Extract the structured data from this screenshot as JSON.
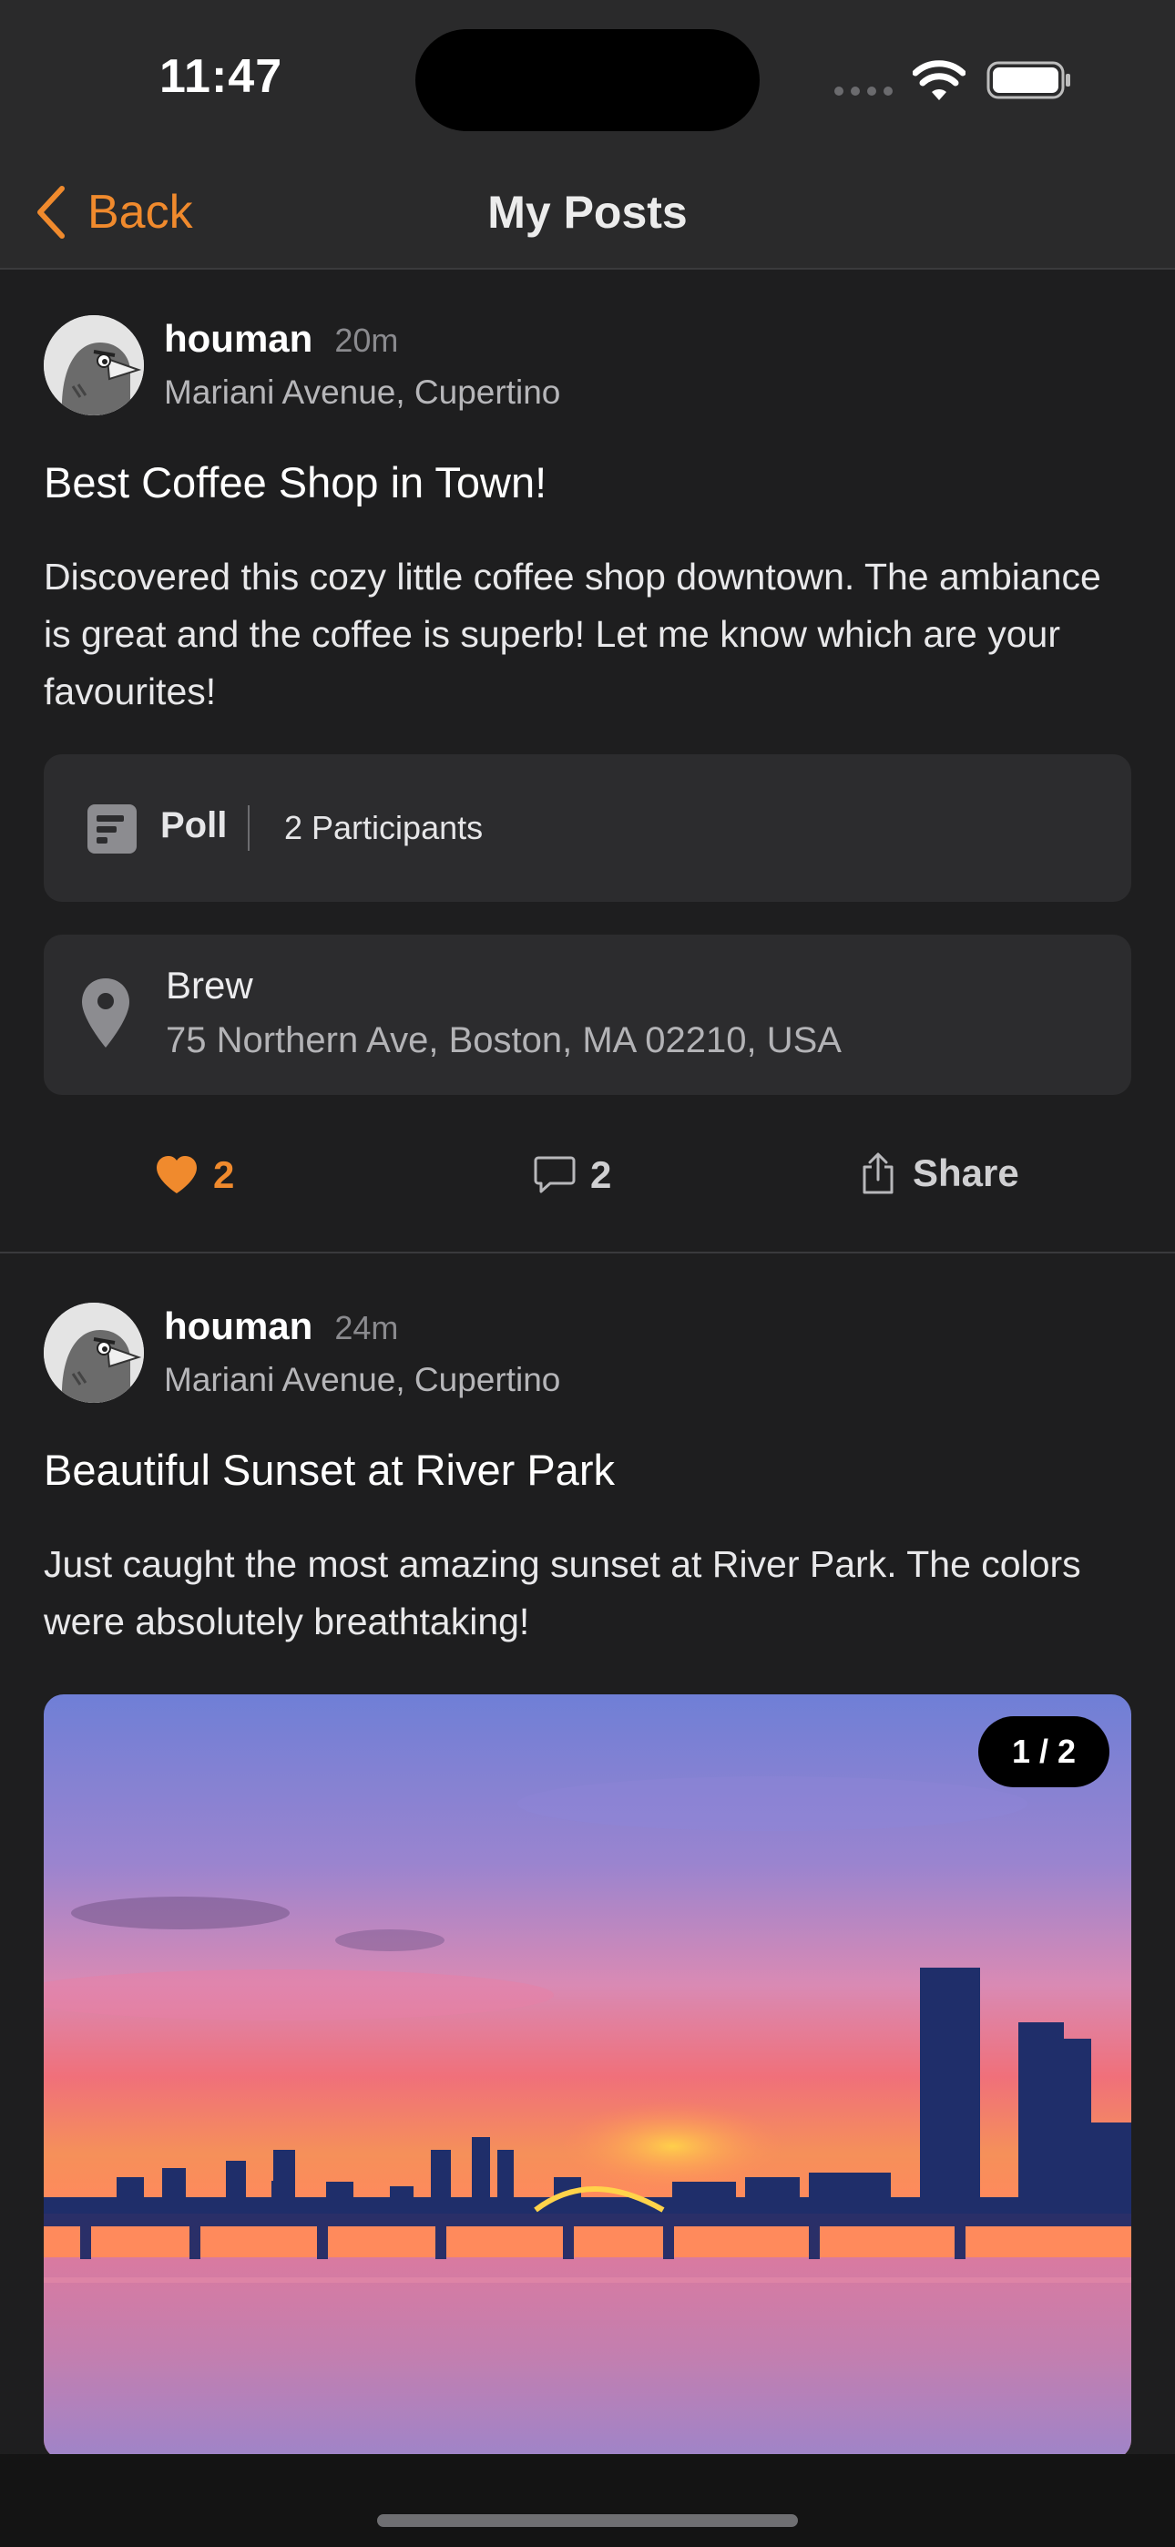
{
  "status_bar": {
    "time": "11:47"
  },
  "nav": {
    "back_label": "Back",
    "title": "My Posts"
  },
  "posts": [
    {
      "username": "houman",
      "time_ago": "20m",
      "location": "Mariani Avenue, Cupertino",
      "title": "Best Coffee Shop in Town!",
      "body": "Discovered this cozy little coffee shop downtown. The ambiance is great and the coffee is superb! Let me know which are your favourites!",
      "poll": {
        "label": "Poll",
        "participants": "2 Participants"
      },
      "place": {
        "name": "Brew",
        "address": "75 Northern Ave, Boston, MA 02210, USA"
      },
      "likes": "2",
      "comments": "2",
      "share_label": "Share"
    },
    {
      "username": "houman",
      "time_ago": "24m",
      "location": "Mariani Avenue, Cupertino",
      "title": "Beautiful Sunset at River Park",
      "body": "Just caught the most amazing sunset at River Park. The colors were absolutely breathtaking!",
      "photo_counter": "1 / 2"
    }
  ],
  "colors": {
    "accent": "#f08a2d",
    "background": "#1e1e1f",
    "card": "#2c2c2e",
    "bar": "#2a2a2b"
  }
}
